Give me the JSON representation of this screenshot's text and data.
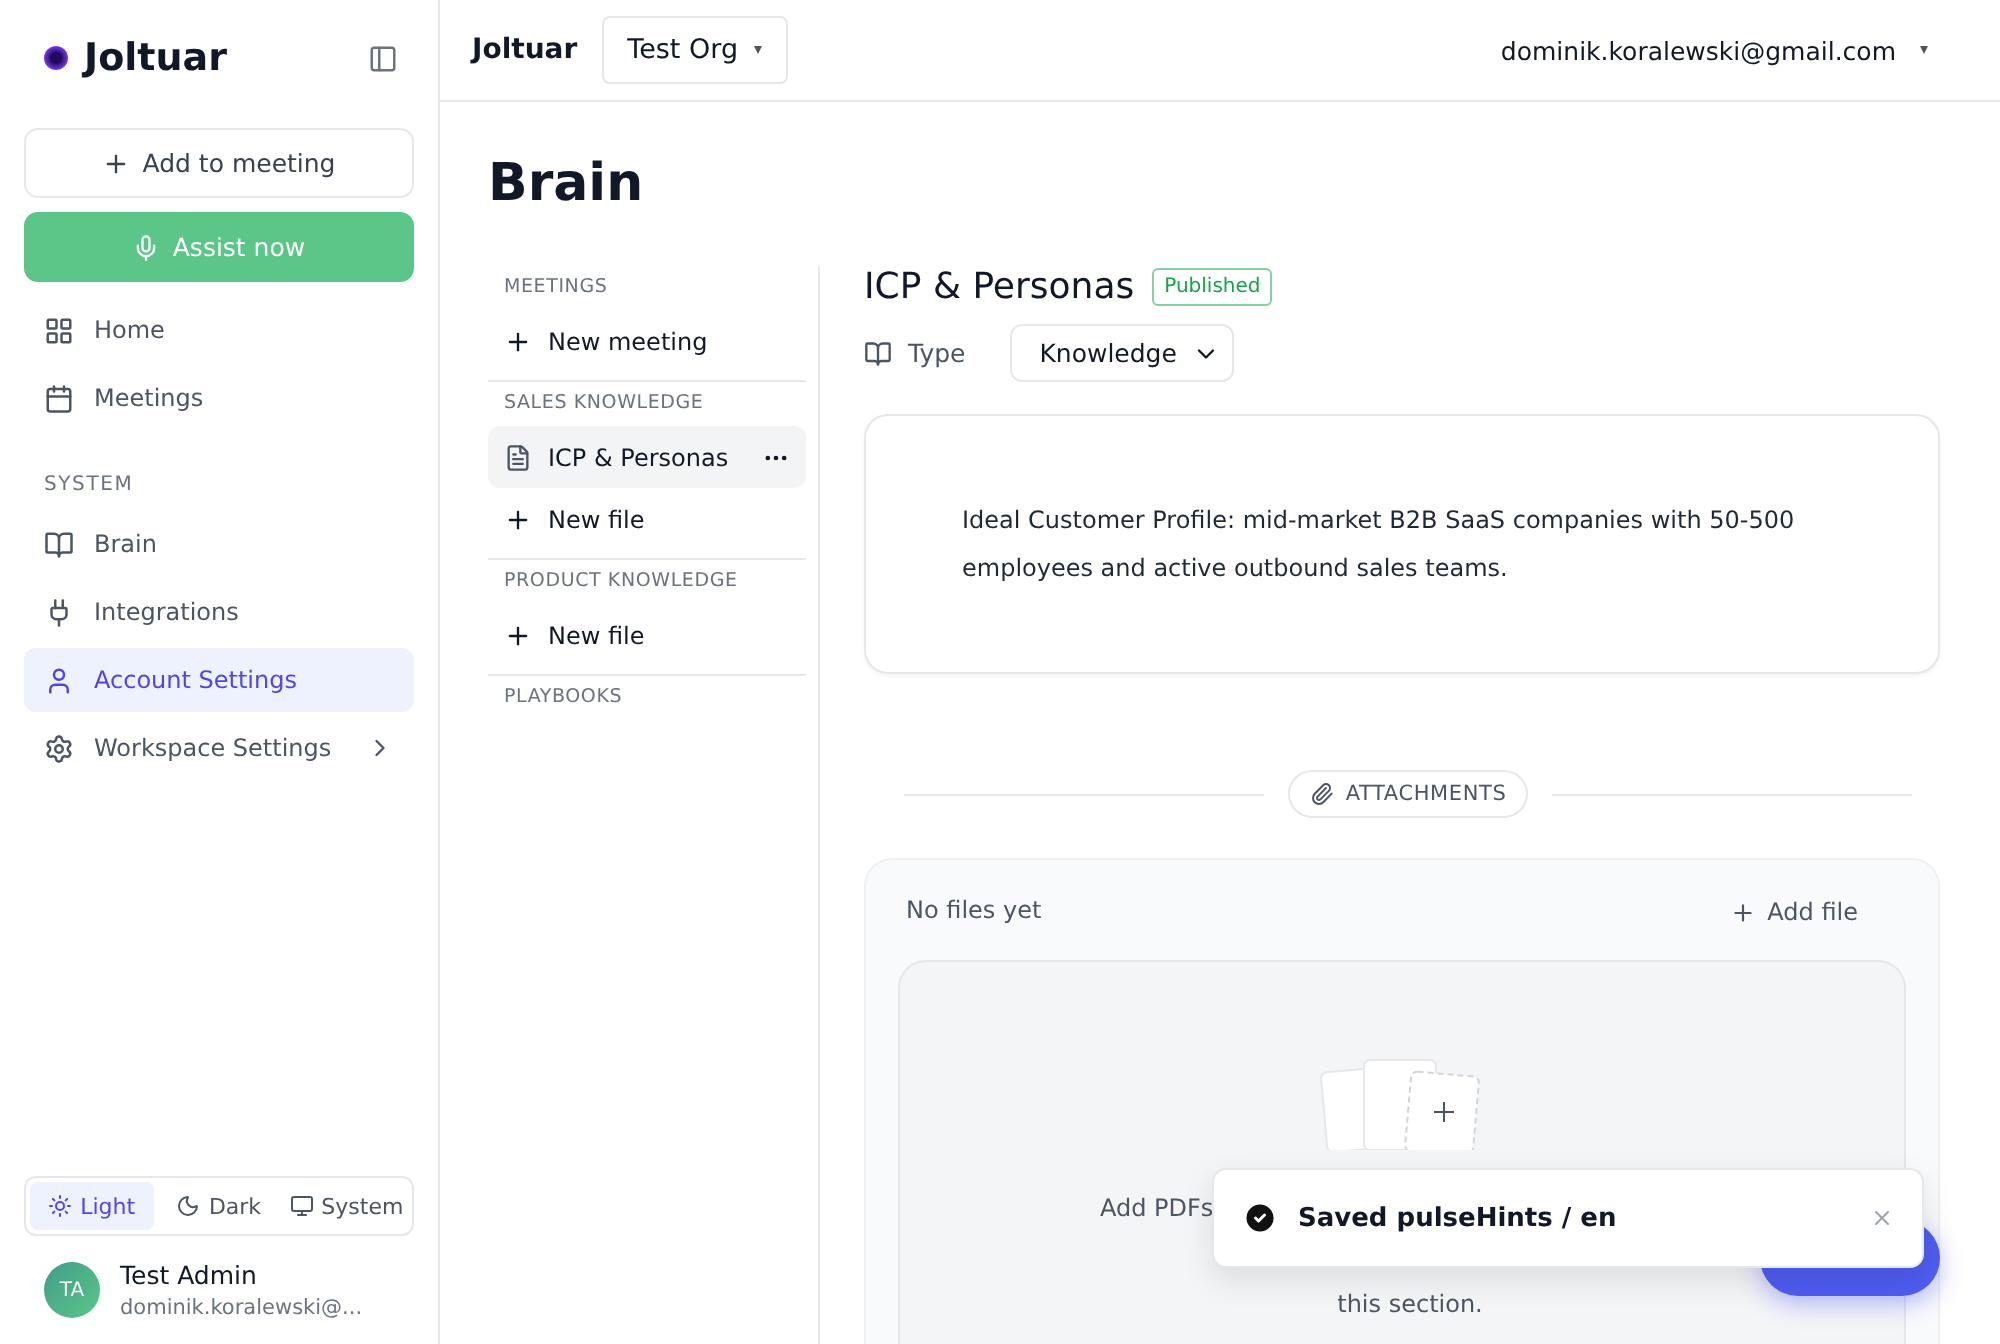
{
  "sidebar": {
    "brand": "Joltuar",
    "add_button": "Add to meeting",
    "assist_button": "Assist now",
    "nav": [
      {
        "label": "Home",
        "selected": false,
        "expandable": false
      },
      {
        "label": "Meetings",
        "selected": false,
        "expandable": false
      }
    ],
    "section": "SYSTEM",
    "system_nav": [
      {
        "label": "Brain",
        "selected": false,
        "expandable": false
      },
      {
        "label": "Integrations",
        "selected": false,
        "expandable": false
      },
      {
        "label": "Account Settings",
        "selected": true,
        "expandable": false
      },
      {
        "label": "Workspace Settings",
        "selected": false,
        "expandable": true
      }
    ],
    "theme": [
      {
        "label": "Light",
        "selected": true
      },
      {
        "label": "Dark",
        "selected": false
      },
      {
        "label": "System",
        "selected": false
      }
    ],
    "user": {
      "initials": "TA",
      "name": "Test Admin",
      "email": "dominik.koralewski@..."
    }
  },
  "topbar": {
    "brand": "Joltuar",
    "org": "Test Org",
    "account": "dominik.koralewski@gmail.com"
  },
  "page": {
    "title": "Brain"
  },
  "tree": [
    {
      "heading": "MEETINGS",
      "items": [
        {
          "kind": "new",
          "label": "New meeting",
          "selected": false
        }
      ]
    },
    {
      "heading": "SALES KNOWLEDGE",
      "items": [
        {
          "kind": "file",
          "label": "ICP & Personas",
          "selected": true
        },
        {
          "kind": "new",
          "label": "New file",
          "selected": false
        }
      ]
    },
    {
      "heading": "PRODUCT KNOWLEDGE",
      "items": [
        {
          "kind": "new",
          "label": "New file",
          "selected": false
        }
      ]
    },
    {
      "heading": "PLAYBOOKS"
    }
  ],
  "doc": {
    "title": "ICP & Personas",
    "status": "Published",
    "type_label": "Type",
    "type_value": "Knowledge",
    "body": "Ideal Customer Profile: mid-market B2B SaaS companies with 50-500 employees and active outbound sales teams.",
    "attachments_label": "ATTACHMENTS",
    "empty_text": "No files yet",
    "add_file": "Add file",
    "drop_text_1": "Add PDFs",
    "drop_text_2": "this section."
  },
  "toast": {
    "message": "Saved pulseHints / en"
  }
}
